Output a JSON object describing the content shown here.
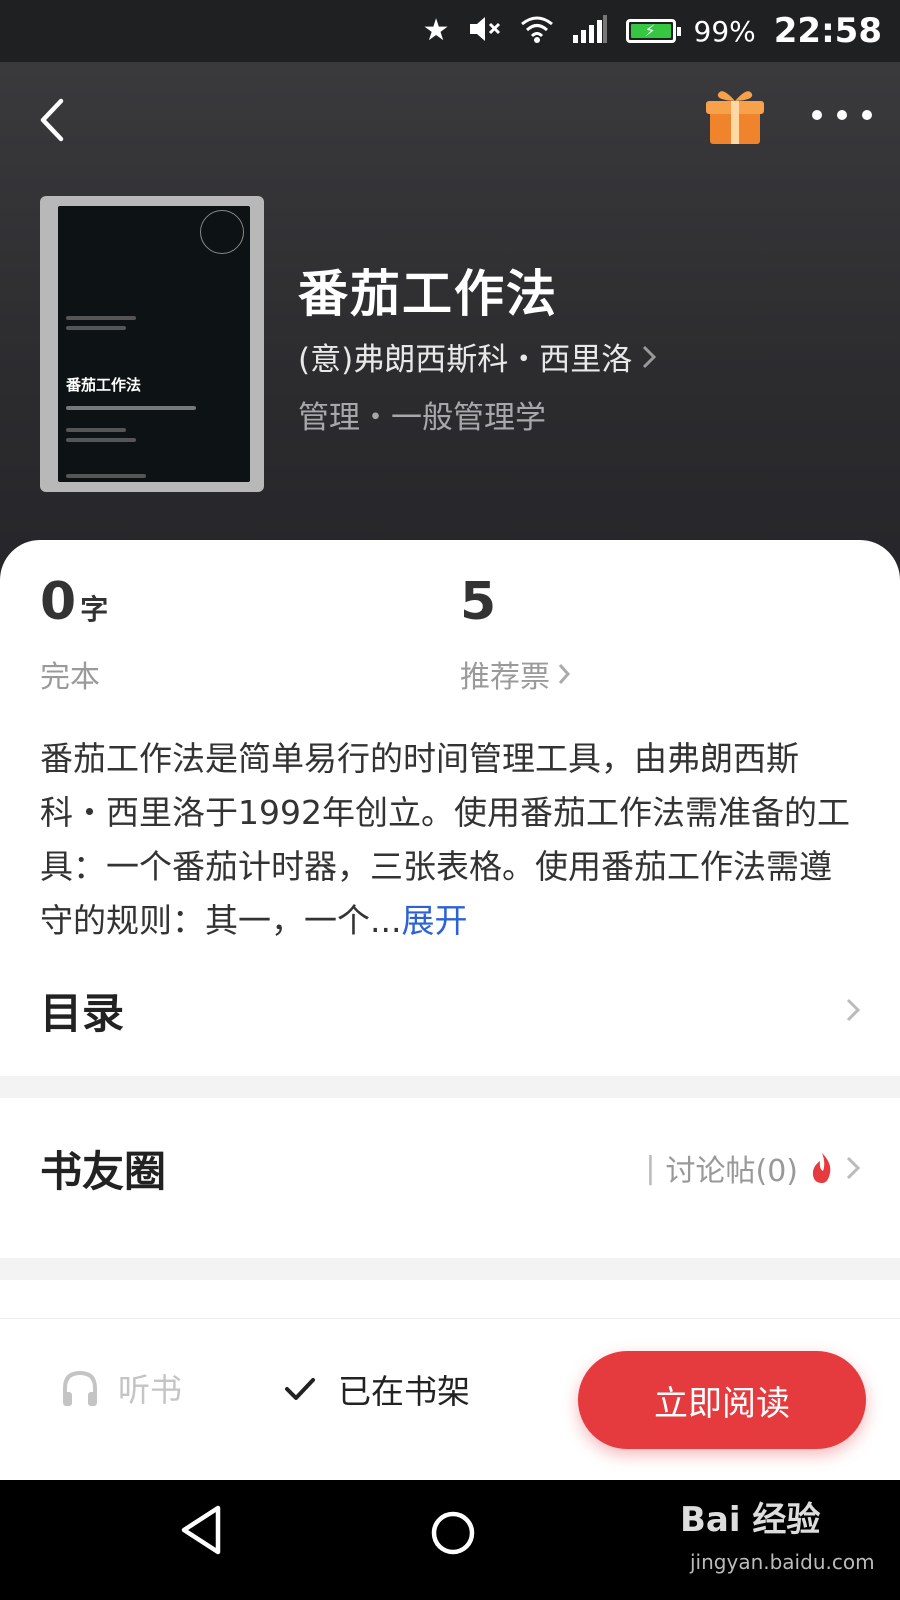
{
  "status_bar": {
    "battery_text": "99%",
    "time": "22:58",
    "battery_color": "#35c642",
    "icons": [
      "star-icon",
      "mute-icon",
      "wifi-icon",
      "signal-icon",
      "battery-icon"
    ]
  },
  "header": {
    "back_icon": "chevron-left-icon",
    "gift_icon": "gift-icon",
    "more_icon": "more-dots-icon"
  },
  "book": {
    "cover_title": "番茄工作法",
    "title": "番茄工作法",
    "author": "(意)弗朗西斯科・西里洛",
    "category": "管理・一般管理学"
  },
  "stats": {
    "words": {
      "value": "0",
      "unit": "字",
      "label": "完本"
    },
    "votes": {
      "value": "5",
      "label": "推荐票"
    }
  },
  "description": {
    "text": "番茄工作法是简单易行的时间管理工具，由弗朗西斯科・西里洛于1992年创立。使用番茄工作法需准备的工具：一个番茄计时器，三张表格。使用番茄工作法需遵守的规则：其一，一个...",
    "expand_label": "展开",
    "link_color": "#2c62d6"
  },
  "toc": {
    "title": "目录"
  },
  "community": {
    "title": "书友圈",
    "posts_label": "讨论帖(0)",
    "hot_icon": "flame-icon"
  },
  "actions": {
    "listen_label": "听书",
    "shelf_label": "已在书架",
    "read_label": "立即阅读",
    "accent_color": "#e53a3e"
  },
  "nav": {
    "watermark": "Bai 经验",
    "watermark_sub": "jingyan.baidu.com"
  }
}
